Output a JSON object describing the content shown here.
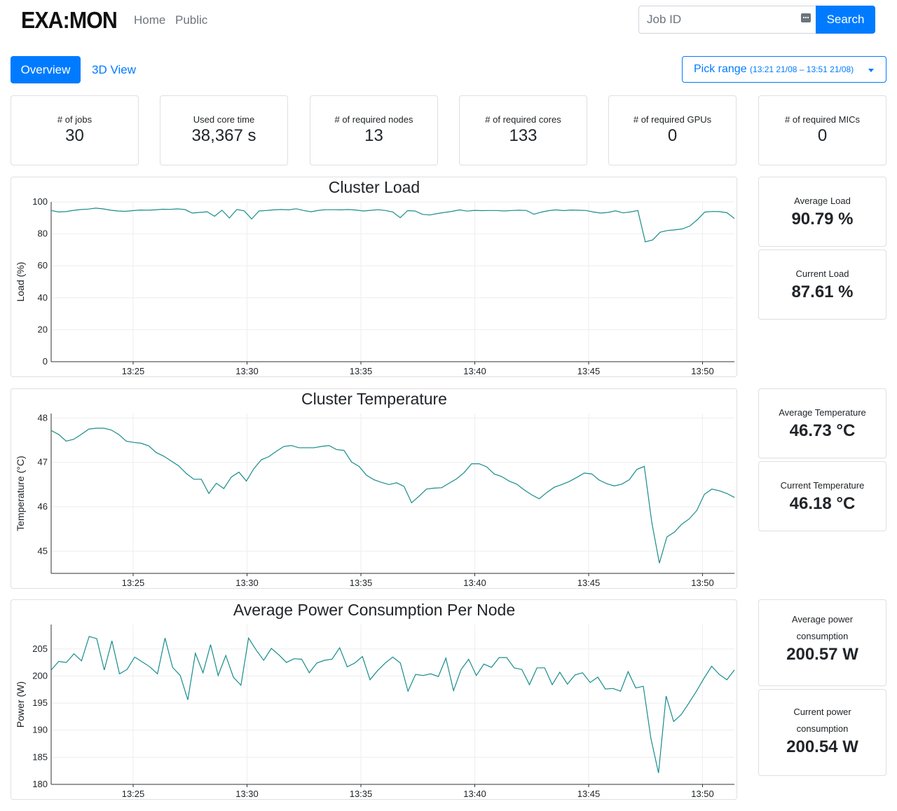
{
  "nav": {
    "logo": "EXA:MON",
    "links": [
      "Home",
      "Public"
    ],
    "search_placeholder": "Job ID",
    "search_label": "Search"
  },
  "tabs": {
    "overview": "Overview",
    "view3d": "3D View"
  },
  "range": {
    "label": "Pick range",
    "value": "(13:21 21/08 – 13:51 21/08)"
  },
  "stats": [
    {
      "label": "# of jobs",
      "value": "30"
    },
    {
      "label": "Used core time",
      "value": "38,367 s"
    },
    {
      "label": "# of required nodes",
      "value": "13"
    },
    {
      "label": "# of required cores",
      "value": "133"
    },
    {
      "label": "# of required GPUs",
      "value": "0"
    },
    {
      "label": "# of required MICs",
      "value": "0"
    }
  ],
  "side": {
    "avg_load": {
      "label": "Average Load",
      "value": "90.79 %"
    },
    "cur_load": {
      "label": "Current Load",
      "value": "87.61 %"
    },
    "avg_temp": {
      "label": "Average Temperature",
      "value": "46.73 °C"
    },
    "cur_temp": {
      "label": "Current Temperature",
      "value": "46.18 °C"
    },
    "avg_power": {
      "label": "Average power consumption",
      "value": "200.57 W"
    },
    "cur_power": {
      "label": "Current power consumption",
      "value": "200.54 W"
    }
  },
  "colors": {
    "accent": "#007bff",
    "series": "#1a8c8c"
  },
  "chart_data": [
    {
      "type": "line",
      "title": "Cluster Load",
      "ylabel": "Load (%)",
      "xlabel": "",
      "ylim": [
        0,
        100
      ],
      "yticks": [
        0,
        20,
        40,
        60,
        80,
        100
      ],
      "xlim": [
        21.4,
        51.4
      ],
      "xticks": [
        25,
        30,
        35,
        40,
        45,
        50
      ],
      "xtick_labels": [
        "13:25",
        "13:30",
        "13:35",
        "13:40",
        "13:45",
        "13:50"
      ],
      "grid": true,
      "values": [
        94.6,
        93.7,
        93.9,
        94.7,
        95.2,
        95.5,
        96.1,
        95.6,
        94.8,
        94.3,
        94.1,
        94.5,
        94.9,
        94.8,
        95.0,
        95.4,
        95.3,
        95.6,
        95.2,
        93.0,
        93.4,
        93.8,
        91.0,
        94.8,
        89.9,
        95.2,
        94.4,
        89.3,
        94.3,
        94.6,
        95.0,
        95.2,
        95.0,
        95.7,
        94.6,
        93.8,
        94.7,
        95.1,
        95.1,
        95.0,
        95.2,
        94.9,
        94.3,
        94.7,
        95.1,
        94.6,
        93.7,
        90.1,
        94.5,
        94.3,
        92.2,
        91.8,
        92.7,
        93.4,
        94.1,
        95.0,
        94.2,
        94.7,
        94.5,
        94.6,
        94.6,
        94.3,
        94.6,
        94.8,
        94.6,
        92.3,
        93.6,
        94.5,
        95.0,
        94.5,
        94.9,
        94.8,
        94.6,
        93.7,
        93.0,
        93.4,
        94.4,
        93.1,
        93.7,
        94.6,
        75.0,
        76.2,
        81.0,
        82.1,
        82.5,
        83.1,
        84.9,
        88.8,
        93.6,
        94.0,
        93.9,
        93.2,
        89.6
      ]
    },
    {
      "type": "line",
      "title": "Cluster Temperature",
      "ylabel": "Temperature (°C)",
      "xlabel": "",
      "ylim": [
        44.5,
        48.1
      ],
      "yticks": [
        45,
        46,
        47,
        48
      ],
      "xlim": [
        21.4,
        51.4
      ],
      "xticks": [
        25,
        30,
        35,
        40,
        45,
        50
      ],
      "xtick_labels": [
        "13:25",
        "13:30",
        "13:35",
        "13:40",
        "13:45",
        "13:50"
      ],
      "grid": true,
      "values": [
        47.72,
        47.63,
        47.48,
        47.52,
        47.63,
        47.75,
        47.77,
        47.77,
        47.73,
        47.63,
        47.48,
        47.45,
        47.43,
        47.37,
        47.22,
        47.14,
        47.03,
        46.92,
        46.75,
        46.62,
        46.62,
        46.3,
        46.53,
        46.41,
        46.67,
        46.78,
        46.58,
        46.86,
        47.06,
        47.13,
        47.25,
        47.36,
        47.38,
        47.33,
        47.33,
        47.33,
        47.36,
        47.38,
        47.29,
        47.27,
        47.01,
        46.91,
        46.71,
        46.61,
        46.55,
        46.5,
        46.54,
        46.46,
        46.09,
        46.24,
        46.4,
        46.42,
        46.43,
        46.53,
        46.63,
        46.77,
        46.97,
        46.97,
        46.9,
        46.74,
        46.68,
        46.58,
        46.51,
        46.38,
        46.27,
        46.18,
        46.32,
        46.44,
        46.5,
        46.57,
        46.66,
        46.76,
        46.74,
        46.6,
        46.52,
        46.47,
        46.51,
        46.61,
        46.84,
        46.91,
        45.65,
        44.73,
        45.32,
        45.43,
        45.61,
        45.73,
        45.92,
        46.28,
        46.4,
        46.36,
        46.3,
        46.21
      ]
    },
    {
      "type": "line",
      "title": "Average Power Consumption Per Node",
      "ylabel": "Power (W)",
      "xlabel": "",
      "ylim": [
        180,
        209.5
      ],
      "yticks": [
        180,
        185,
        190,
        195,
        200,
        205
      ],
      "xlim": [
        21.4,
        51.4
      ],
      "xticks": [
        25,
        30,
        35,
        40,
        45,
        50
      ],
      "xtick_labels": [
        "13:25",
        "13:30",
        "13:35",
        "13:40",
        "13:45",
        "13:50"
      ],
      "grid": true,
      "values": [
        201.1,
        202.7,
        202.5,
        204.1,
        202.8,
        207.3,
        206.9,
        201.1,
        206.5,
        200.4,
        201.2,
        203.5,
        202.6,
        201.7,
        200.4,
        207.0,
        201.6,
        200.1,
        195.6,
        204.2,
        200.6,
        205.8,
        200.1,
        203.8,
        199.8,
        198.3,
        207.0,
        204.8,
        202.9,
        205.1,
        203.9,
        202.5,
        203.2,
        203.1,
        200.6,
        202.4,
        202.9,
        203.1,
        205.2,
        201.7,
        202.4,
        203.6,
        199.3,
        201.0,
        202.4,
        203.5,
        202.4,
        197.2,
        200.3,
        200.1,
        200.4,
        199.9,
        203.3,
        197.3,
        201.2,
        203.1,
        200.1,
        202.2,
        201.6,
        203.4,
        203.4,
        201.5,
        201.2,
        198.4,
        201.5,
        201.5,
        198.4,
        200.7,
        198.5,
        200.2,
        200.6,
        198.8,
        199.8,
        197.6,
        197.7,
        197.2,
        200.8,
        197.8,
        198.1,
        188.5,
        182.1,
        196.3,
        191.6,
        192.9,
        195.0,
        197.2,
        199.6,
        201.8,
        200.3,
        199.3,
        201.1
      ]
    }
  ]
}
